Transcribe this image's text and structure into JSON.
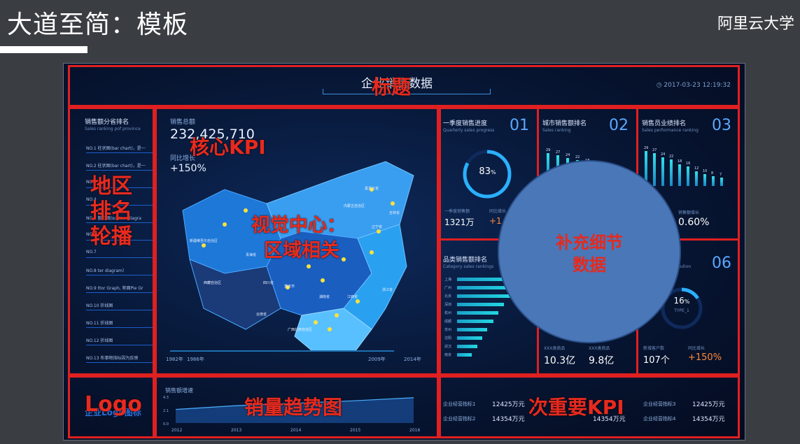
{
  "slide": {
    "title": "大道至简：模板",
    "brand": "阿里云大学"
  },
  "dashboard": {
    "title": "企业销售数据",
    "timestamp": "2017-03-23 12:19:32",
    "total_sales_label": "销售总额",
    "total_sales_value": "232,425,710",
    "yoy_label": "同比增长",
    "yoy_value": "+150%",
    "ranking": {
      "title": "销售额分省排名",
      "subtitle": "Sales ranking pof province",
      "items": [
        "NO.1  柱状图(bar chart)，是一",
        "NO.2  柱状图(bar chart)，是一",
        "NO.3",
        "NO.4",
        "NO.5  散点图(scatter diagra",
        "NO.6",
        "NO.7",
        "NO.8  ter diagram）",
        "NO.9  ttor Graph, 称面Pie Gr",
        "NO.10  折线图",
        "NO.11  折线图",
        "NO.12  折线图",
        "NO.13  布事物指标因为反映"
      ]
    },
    "map": {
      "timeline_start": "1982年",
      "timeline_second": "1986年",
      "timeline_third": "2009年",
      "timeline_end": "2014年",
      "region_labels": [
        "新疆维吾尔自治区",
        "西藏自治区",
        "青海省",
        "四川省",
        "重庆市",
        "云南省",
        "广西壮族自治区",
        "黑龙江省",
        "吉林省",
        "内蒙古自治区",
        "辽宁省",
        "浙江省",
        "江西省",
        "湖南省"
      ]
    },
    "card1": {
      "title": "一季度销售进度",
      "subtitle": "Quarterly sales progress",
      "num": "01",
      "percent": 83,
      "percent_label": "83",
      "percent_unit": "%",
      "kpi_label_1": "一季度销售额",
      "kpi_value_1": "1321万",
      "kpi_label_2": "同比增长",
      "kpi_value_2": "+1"
    },
    "card2": {
      "title": "城市销售额排名",
      "subtitle": "Sales ranking",
      "num": "02",
      "values": [
        29,
        27,
        24,
        22,
        18,
        14,
        10
      ]
    },
    "card3": {
      "title": "销售员业绩排名",
      "subtitle": "Sales performance ranking",
      "num": "03",
      "values": [
        29,
        27,
        24,
        22,
        18,
        16,
        12,
        10,
        8,
        7
      ],
      "kpi_label": "销售额增长",
      "kpi_value": "0.60%"
    },
    "card4": {
      "title": "品类销售额排名",
      "subtitle": "Category sales rankings",
      "values": [
        0.95,
        0.88,
        0.8,
        0.7,
        0.62,
        0.55,
        0.45,
        0.38,
        0.3,
        0.22
      ],
      "categories": [
        "上海",
        "广州",
        "北京",
        "深圳",
        "杭州",
        "成都",
        "苏州",
        "沈阳",
        "武汉",
        "南京"
      ]
    },
    "card5": {
      "kpi_label_1": "XXX类商品",
      "kpi_value_1": "10.3亿",
      "kpi_label_2": "XXX类商品",
      "kpi_value_2": "9.8亿"
    },
    "card6": {
      "title": "distribution",
      "num": "06",
      "percent": 16,
      "percent_label": "16",
      "percent_unit": "%",
      "type_label": "TYPE_1",
      "kpi_label_1": "新增客户数",
      "kpi_value_1": "107个",
      "kpi_label_2": "同比增长",
      "kpi_value_2": "+150%"
    },
    "trend": {
      "title": "销售额增速",
      "years": [
        "2012",
        "2013",
        "2014",
        "2015",
        "2016"
      ],
      "values": [
        2.2,
        2.8,
        3.2,
        3.6,
        4.1
      ],
      "yticks": [
        "4.3",
        "2.1",
        "0.0"
      ]
    },
    "secondary_kpis": [
      {
        "label": "企业经营指标1",
        "value": "12425万元"
      },
      {
        "label": "企业经营指标2",
        "value": "14354万元"
      },
      {
        "label": "企业经营指标3",
        "value": "12425万元"
      },
      {
        "label": "企业经营指标4",
        "value": "14354万元"
      }
    ],
    "secondary_kpis_mid": "14354万元",
    "logo_text": "企业Logo图标"
  },
  "annotations": {
    "title": "标题",
    "core_kpi": "核心KPI",
    "region_rank": [
      "地区",
      "排名",
      "轮播"
    ],
    "visual_center": [
      "视觉中心：",
      "区域相关"
    ],
    "supplement": [
      "补充细节",
      "数据"
    ],
    "logo": "Logo",
    "trend": "销量趋势图",
    "secondary_kpi": "次重要KPI"
  },
  "colors": {
    "annotation": "#e52a1e",
    "accent": "#23d6e2",
    "screen_bg": "#06122e",
    "overlay": "#4a77b8"
  }
}
